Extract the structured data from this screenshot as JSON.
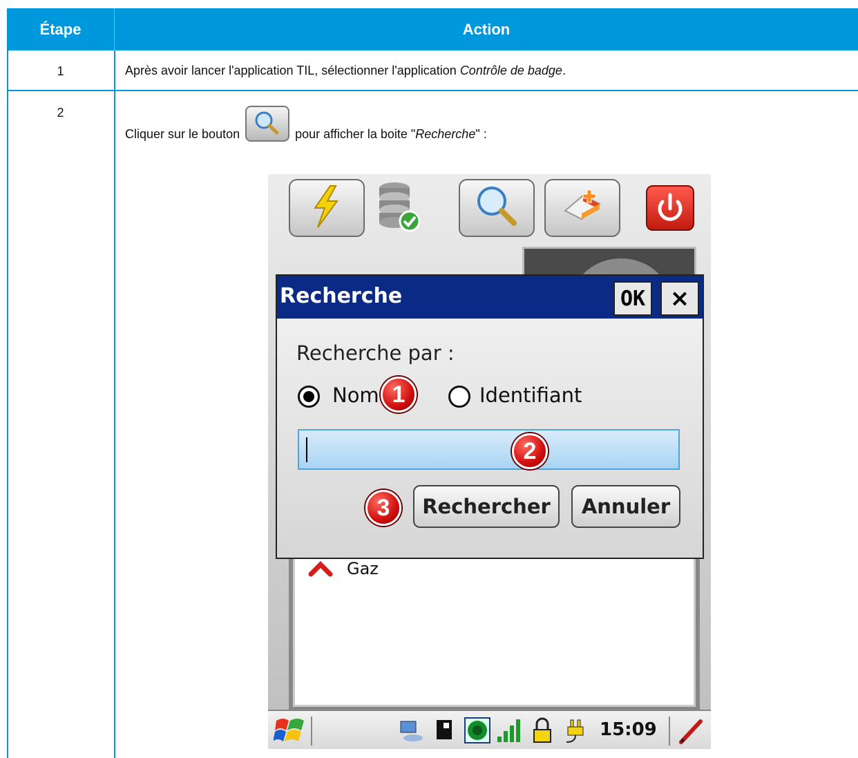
{
  "table": {
    "headers": {
      "step": "Étape",
      "action": "Action"
    },
    "rows": [
      {
        "step": "1",
        "text_before": "Après avoir lancer l'application TIL, sélectionner l'application ",
        "text_em": "Contrôle de badge",
        "text_after": "."
      },
      {
        "step": "2",
        "text_before": "Cliquer sur le bouton",
        "text_middle": "pour afficher la boite \"",
        "text_em": "Recherche",
        "text_after": "\" :"
      }
    ]
  },
  "screenshot": {
    "toolbar": {
      "buttons": [
        "flash-icon",
        "database-check-icon",
        "search-icon",
        "eraser-icon",
        "power-icon"
      ]
    },
    "dialog": {
      "title": "Recherche",
      "ok_label": "OK",
      "close_label": "×",
      "search_by_label": "Recherche par :",
      "radio_name_label": "Nom",
      "radio_id_label": "Identifiant",
      "selected": "Nom",
      "search_value": "",
      "search_button": "Rechercher",
      "cancel_button": "Annuler"
    },
    "callouts": [
      "1",
      "2",
      "3"
    ],
    "list": {
      "items": [
        "Gaz"
      ]
    },
    "taskbar": {
      "time": "15:09"
    },
    "colors": {
      "accent": "#0098dd",
      "dialog_title": "#0b2a86",
      "badge": "#d10f0f"
    }
  }
}
